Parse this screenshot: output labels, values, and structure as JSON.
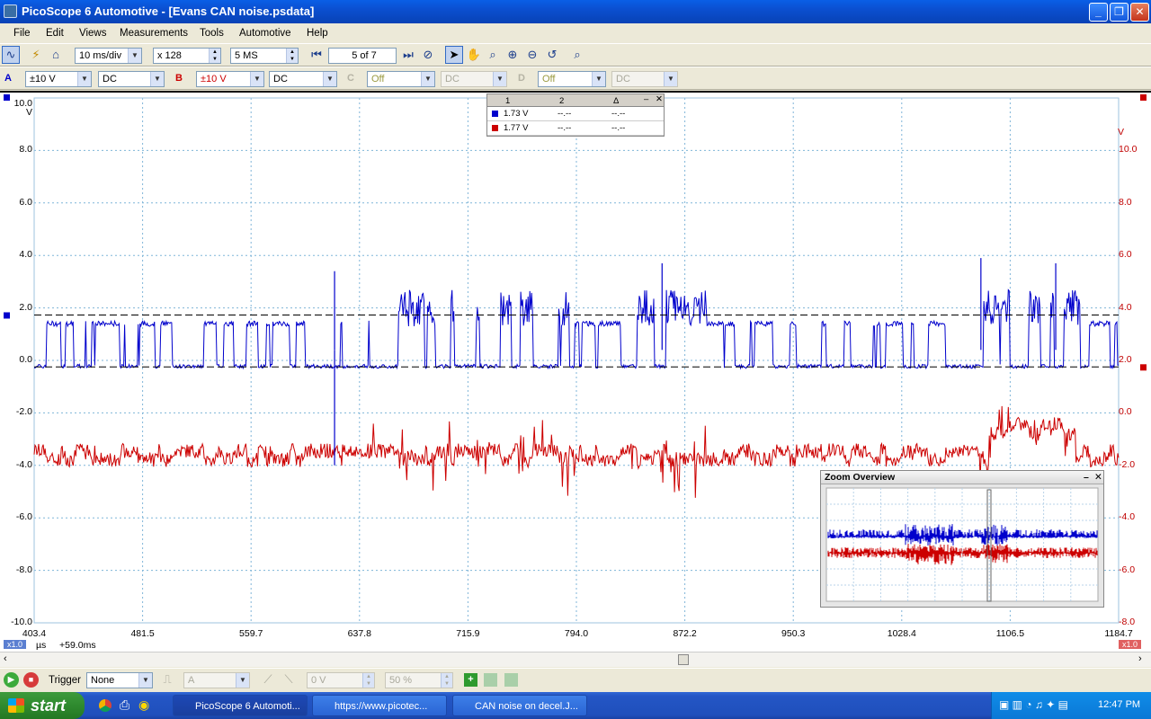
{
  "window": {
    "title": "PicoScope 6 Automotive - [Evans CAN noise.psdata]"
  },
  "menu": [
    "File",
    "Edit",
    "Views",
    "Measurements",
    "Tools",
    "Automotive",
    "Help"
  ],
  "toolbar": {
    "timebase": "10 ms/div",
    "zoom": "x 128",
    "samples": "5 MS",
    "buffer": "5 of 7"
  },
  "channels": {
    "a": {
      "label": "A",
      "range": "±10 V",
      "coupling": "DC"
    },
    "b": {
      "label": "B",
      "range": "±10 V",
      "coupling": "DC"
    },
    "c": {
      "label": "C",
      "range": "Off",
      "coupling": "DC"
    },
    "d": {
      "label": "D",
      "range": "Off",
      "coupling": "DC"
    }
  },
  "scope": {
    "left_axis": {
      "unit": "V",
      "ticks": [
        "10.0",
        "8.0",
        "6.0",
        "4.0",
        "2.0",
        "0.0",
        "-2.0",
        "-4.0",
        "-6.0",
        "-8.0",
        "-10.0"
      ]
    },
    "right_axis": {
      "unit": "V",
      "ticks": [
        "10.0",
        "8.0",
        "6.0",
        "4.0",
        "2.0",
        "0.0",
        "-2.0",
        "-4.0",
        "-6.0",
        "-8.0"
      ]
    },
    "x_ticks": [
      "403.4",
      "481.5",
      "559.7",
      "637.8",
      "715.9",
      "794.0",
      "872.2",
      "950.3",
      "1028.4",
      "1106.5",
      "1184.7"
    ],
    "x_unit": "µs",
    "x_offset": "+59.0ms",
    "zoom_badge_left": "x1.0",
    "zoom_badge_right": "x1.0"
  },
  "chart_data": {
    "type": "line",
    "x_range": [
      403.4,
      1184.7
    ],
    "x_unit": "µs",
    "series": [
      {
        "name": "A",
        "color": "#0000cc",
        "ylim": [
          -10,
          10
        ],
        "y_unit": "V"
      },
      {
        "name": "B",
        "color": "#cc0000",
        "ylim": [
          -8,
          10
        ],
        "y_unit": "V"
      }
    ],
    "rulers": [
      {
        "channel": "A",
        "value": 1.73
      },
      {
        "channel": "B",
        "value": 1.77
      }
    ]
  },
  "measurements": {
    "headers": [
      "1",
      "2",
      "Δ"
    ],
    "rows": [
      {
        "v1": "1.73 V",
        "v2": "--.--",
        "delta": "--.--",
        "color": "#0000cc"
      },
      {
        "v1": "1.77 V",
        "v2": "--.--",
        "delta": "--.--",
        "color": "#cc0000"
      }
    ]
  },
  "zoom_overview": {
    "title": "Zoom Overview"
  },
  "trigger": {
    "label": "Trigger",
    "mode": "None",
    "source": "A",
    "level": "0 V",
    "position": "50 %"
  },
  "taskbar": {
    "start": "start",
    "tasks": [
      "PicoScope 6 Automoti...",
      "https://www.picotec...",
      "CAN noise on decel.J..."
    ],
    "clock": "12:47 PM"
  }
}
